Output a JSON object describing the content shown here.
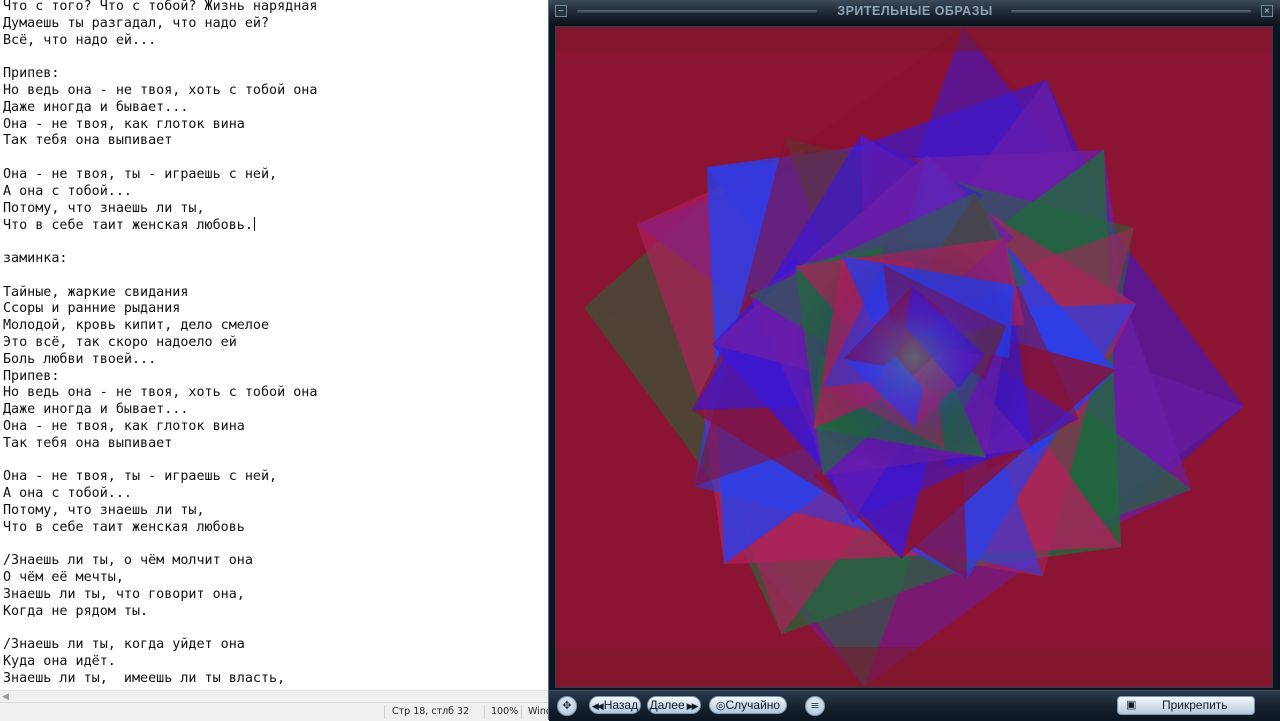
{
  "notepad": {
    "lines": [
      "Что с того? Что с тобой? Жизнь нарядная",
      "Думаешь ты разгадал, что надо ей?",
      "Всё, что надо ей...",
      "",
      "Припев:",
      "Но ведь она - не твоя, хоть с тобой она",
      "Даже иногда и бывает...",
      "Она - не твоя, как глоток вина",
      "Так тебя она выпивает",
      "",
      "Она - не твоя, ты - играешь с ней,",
      "А она с тобой...",
      "Потому, что знаешь ли ты,",
      "Что в себе таит женская любовь.",
      "",
      "заминка:",
      "",
      "Тайные, жаркие свидания",
      "Ссоры и ранние рыдания",
      "Молодой, кровь кипит, дело смелое",
      "Это всё, так скоро надоело ей",
      "Боль любви твоей...",
      "Припев:",
      "Но ведь она - не твоя, хоть с тобой она",
      "Даже иногда и бывает...",
      "Она - не твоя, как глоток вина",
      "Так тебя она выпивает",
      "",
      "Она - не твоя, ты - играешь с ней,",
      "А она с тобой...",
      "Потому, что знаешь ли ты,",
      "Что в себе таит женская любовь",
      "",
      "/Знаешь ли ты, о чём молчит она",
      "О чём её мечты,",
      "Знаешь ли ты, что говорит она,",
      "Когда не рядом ты.",
      "",
      "/Знаешь ли ты, когда уйдет она",
      "Куда она идёт.",
      "Знаешь ли ты,  имеешь ли ты власть,"
    ],
    "caret_line": 13,
    "status": {
      "position": "Стр 18, стлб 32",
      "zoom": "100%",
      "encoding": "Wind"
    }
  },
  "player": {
    "title": "ЗРИТЕЛЬНЫЕ ОБРАЗЫ",
    "controls": {
      "back_label": "Назад",
      "next_label": "Далее",
      "random_label": "Случайно",
      "pin_label": "Прикрепить"
    },
    "visualization": {
      "palette": [
        "#8b0f2e",
        "#3a18d8",
        "#6c1ea8",
        "#1f6a3a",
        "#b0205a",
        "#2540f0"
      ]
    }
  }
}
